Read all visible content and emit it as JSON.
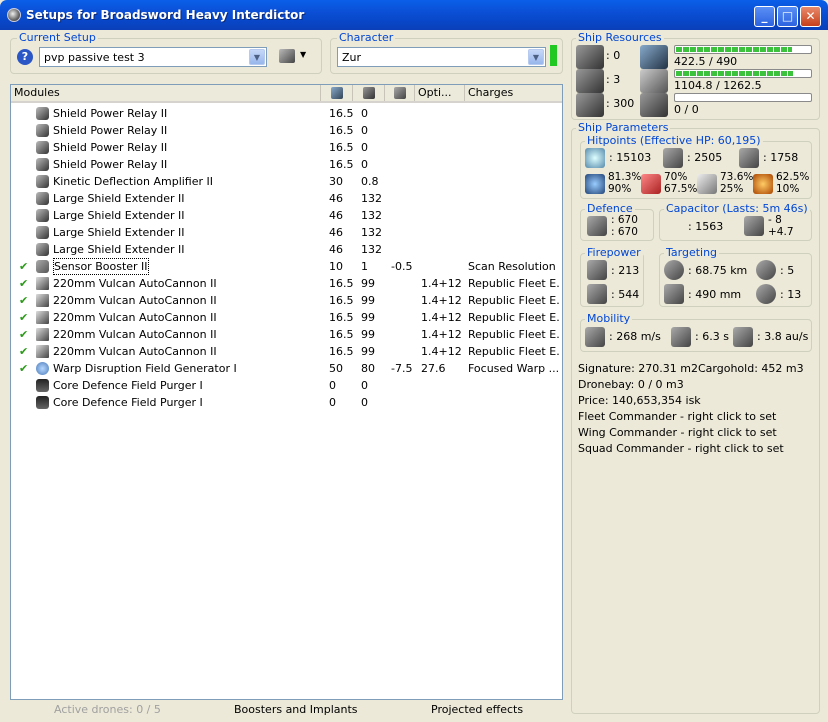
{
  "window": {
    "title": "Setups for Broadsword Heavy Interdictor"
  },
  "setup": {
    "label": "Current Setup",
    "value": "pvp passive test 3"
  },
  "character": {
    "label": "Character",
    "value": "Zur",
    "status_color": "#22c822"
  },
  "modules": {
    "headers": [
      "Modules",
      "",
      "",
      "",
      "Opti...",
      "Charges"
    ],
    "rows": [
      {
        "check": "",
        "icon": "shield",
        "name": "Shield Power Relay II",
        "c1": "16.5",
        "c2": "0",
        "c3": "",
        "c4": "",
        "charge": ""
      },
      {
        "check": "",
        "icon": "shield",
        "name": "Shield Power Relay II",
        "c1": "16.5",
        "c2": "0",
        "c3": "",
        "c4": "",
        "charge": ""
      },
      {
        "check": "",
        "icon": "shield",
        "name": "Shield Power Relay II",
        "c1": "16.5",
        "c2": "0",
        "c3": "",
        "c4": "",
        "charge": ""
      },
      {
        "check": "",
        "icon": "shield",
        "name": "Shield Power Relay II",
        "c1": "16.5",
        "c2": "0",
        "c3": "",
        "c4": "",
        "charge": ""
      },
      {
        "check": "",
        "icon": "shield",
        "name": "Kinetic Deflection Amplifier II",
        "c1": "30",
        "c2": "0.8",
        "c3": "",
        "c4": "",
        "charge": ""
      },
      {
        "check": "",
        "icon": "shield",
        "name": "Large Shield Extender II",
        "c1": "46",
        "c2": "132",
        "c3": "",
        "c4": "",
        "charge": ""
      },
      {
        "check": "",
        "icon": "shield",
        "name": "Large Shield Extender II",
        "c1": "46",
        "c2": "132",
        "c3": "",
        "c4": "",
        "charge": ""
      },
      {
        "check": "",
        "icon": "shield",
        "name": "Large Shield Extender II",
        "c1": "46",
        "c2": "132",
        "c3": "",
        "c4": "",
        "charge": ""
      },
      {
        "check": "",
        "icon": "shield",
        "name": "Large Shield Extender II",
        "c1": "46",
        "c2": "132",
        "c3": "",
        "c4": "",
        "charge": ""
      },
      {
        "check": "✔",
        "icon": "sensor",
        "name": "Sensor Booster II",
        "c1": "10",
        "c2": "1",
        "c3": "-0.5",
        "c4": "",
        "charge": "Scan Resolution"
      },
      {
        "check": "✔",
        "icon": "gun",
        "name": "220mm Vulcan AutoCannon II",
        "c1": "16.5",
        "c2": "99",
        "c3": "",
        "c4": "1.4+12",
        "charge": "Republic Fleet E..."
      },
      {
        "check": "✔",
        "icon": "gun",
        "name": "220mm Vulcan AutoCannon II",
        "c1": "16.5",
        "c2": "99",
        "c3": "",
        "c4": "1.4+12",
        "charge": "Republic Fleet E..."
      },
      {
        "check": "✔",
        "icon": "gun",
        "name": "220mm Vulcan AutoCannon II",
        "c1": "16.5",
        "c2": "99",
        "c3": "",
        "c4": "1.4+12",
        "charge": "Republic Fleet E..."
      },
      {
        "check": "✔",
        "icon": "gun",
        "name": "220mm Vulcan AutoCannon II",
        "c1": "16.5",
        "c2": "99",
        "c3": "",
        "c4": "1.4+12",
        "charge": "Republic Fleet E..."
      },
      {
        "check": "✔",
        "icon": "gun",
        "name": "220mm Vulcan AutoCannon II",
        "c1": "16.5",
        "c2": "99",
        "c3": "",
        "c4": "1.4+12",
        "charge": "Republic Fleet E..."
      },
      {
        "check": "✔",
        "icon": "warp",
        "name": "Warp Disruption Field Generator I",
        "c1": "50",
        "c2": "80",
        "c3": "-7.5",
        "c4": "27.6",
        "charge": "Focused Warp ..."
      },
      {
        "check": "",
        "icon": "core",
        "name": "Core Defence Field Purger I",
        "c1": "0",
        "c2": "0",
        "c3": "",
        "c4": "",
        "charge": ""
      },
      {
        "check": "",
        "icon": "core",
        "name": "Core Defence Field Purger I",
        "c1": "0",
        "c2": "0",
        "c3": "",
        "c4": "",
        "charge": ""
      }
    ]
  },
  "status": {
    "drones": "Active drones: 0 / 5",
    "boosters": "Boosters and Implants",
    "projected": "Projected effects"
  },
  "resources": {
    "label": "Ship Resources",
    "turrets": ": 0",
    "launchers": ": 3",
    "calibration": ": 300",
    "cpu": "422.5 / 490",
    "cpu_fill": 0.862,
    "power": "1104.8 / 1262.5",
    "power_fill": 0.875,
    "drone": "0 / 0",
    "drone_fill": 0
  },
  "params": {
    "label": "Ship Parameters",
    "hitpoints": {
      "label": "Hitpoints (Effective HP: 60,195)",
      "shield": ": 15103",
      "armor": ": 2505",
      "hull": ": 1758",
      "em": [
        "81.3%",
        "90%"
      ],
      "thermal": [
        "70%",
        "67.5%"
      ],
      "kinetic": [
        "73.6%",
        "25%"
      ],
      "explosive": [
        "62.5%",
        "10%"
      ]
    },
    "defence": {
      "label": "Defence",
      "a": ": 670",
      "b": ": 670"
    },
    "capacitor": {
      "label": "Capacitor (Lasts: 5m 46s)",
      "amount": ": 1563",
      "delta1": "- 8",
      "delta2": "+4.7"
    },
    "firepower": {
      "label": "Firepower",
      "a": ": 213",
      "b": ": 544"
    },
    "targeting": {
      "label": "Targeting",
      "range": ": 68.75 km",
      "targets": ": 5",
      "res": ": 490 mm",
      "strength": ": 13"
    },
    "mobility": {
      "label": "Mobility",
      "speed": ": 268 m/s",
      "align": ": 6.3 s",
      "warp": ": 3.8 au/s"
    }
  },
  "info": {
    "signature": "Signature: 270.31 m2",
    "cargohold": "Cargohold: 452 m3",
    "dronebay": "Dronebay: 0 / 0 m3",
    "price": "Price: 140,653,354 isk",
    "fleet": "Fleet Commander - right click to set",
    "wing": "Wing Commander - right click to set",
    "squad": "Squad Commander - right click to set"
  }
}
